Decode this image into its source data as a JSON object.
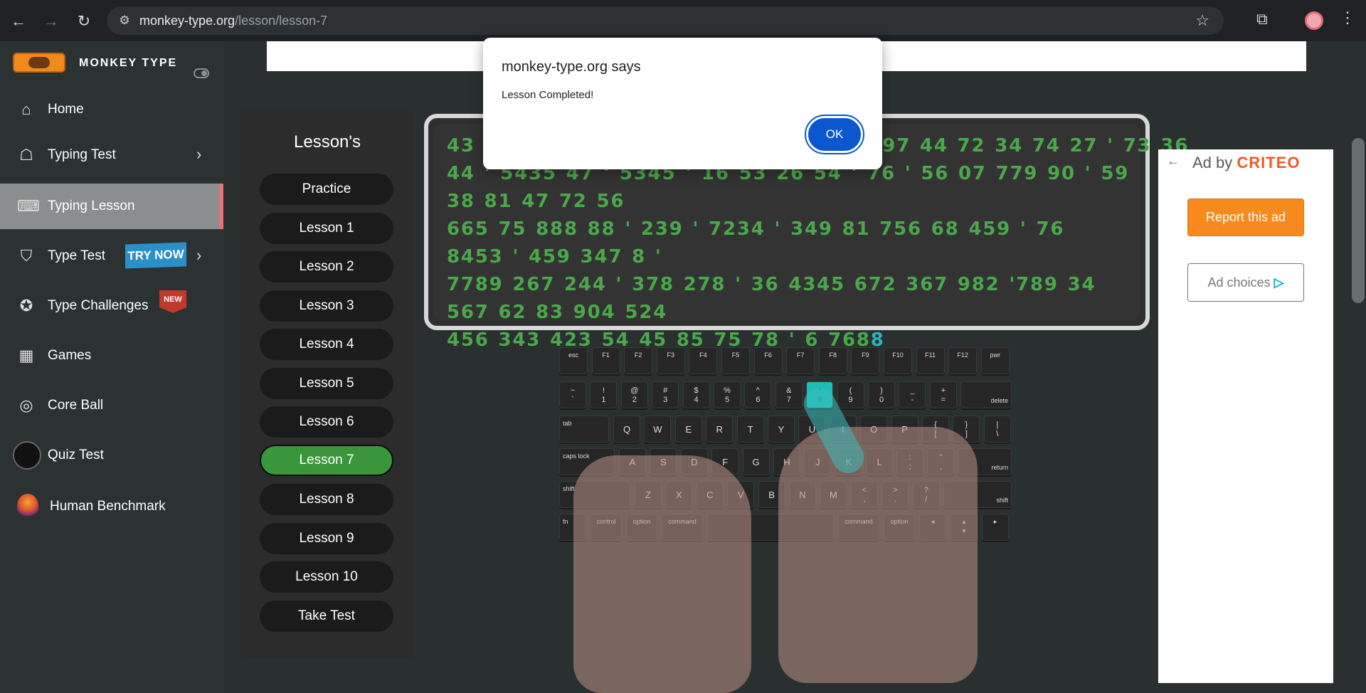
{
  "browser": {
    "url_host": "monkey-type.org",
    "url_path": "/lesson/lesson-7"
  },
  "sidebar": {
    "brand": "MONKEY TYPE",
    "items": [
      {
        "label": "Home",
        "icon": "home-icon"
      },
      {
        "label": "Typing Test",
        "icon": "github-cat-icon"
      },
      {
        "label": "Typing Lesson",
        "icon": "keyboard-icon"
      },
      {
        "label": "Type Test",
        "icon": "gitlab-fox-icon",
        "badge": "TRY NOW"
      },
      {
        "label": "Type Challenges",
        "icon": "award-icon",
        "badge": "NEW"
      },
      {
        "label": "Games",
        "icon": "grid-icon"
      },
      {
        "label": "Core Ball",
        "icon": "target-icon"
      },
      {
        "label": "Quiz Test",
        "icon": "bulb-icon"
      },
      {
        "label": "Human Benchmark",
        "icon": "brain-icon"
      }
    ]
  },
  "lessons": {
    "title": "Lesson's",
    "items": [
      "Practice",
      "Lesson 1",
      "Lesson 2",
      "Lesson 3",
      "Lesson 4",
      "Lesson 5",
      "Lesson 6",
      "Lesson 7",
      "Lesson 8",
      "Lesson 9",
      "Lesson 10",
      "Take Test"
    ],
    "active": "Lesson 7"
  },
  "typing": {
    "lines": [
      "43 0                                          97 44 72 34 74 27 ' 73 36",
      "44 ' 5435 47 ' 5345 ' 16 53 26 54 ' 76 ' 56 07 779 90 ' 59 38 81 47 72 56",
      "665 75 888 88 ' 239 ' 7234 ' 349 81 756 68 459 ' 76 8453 ' 459 347 8 '",
      "7789 267 244 ' 378 278 ' 36 4345 672 367 982 '789 34 567 62 83 904 524"
    ],
    "last_line": "456 343 423 54 45 85 75 78 ' 6 768",
    "cursor_char": "8"
  },
  "keyboard": {
    "row_fn": [
      "esc",
      "F1",
      "F2",
      "F3",
      "F4",
      "F5",
      "F6",
      "F7",
      "F8",
      "F9",
      "F10",
      "F11",
      "F12",
      "pwr"
    ],
    "row_num_top": [
      "~",
      "!",
      "@",
      "#",
      "$",
      "%",
      "^",
      "&",
      "*",
      "(",
      ")",
      "_",
      "+"
    ],
    "row_num_bottom": [
      "`",
      "1",
      "2",
      "3",
      "4",
      "5",
      "6",
      "7",
      "8",
      "9",
      "0",
      "-",
      "="
    ],
    "delete": "delete",
    "tab": "tab",
    "row_q": [
      "Q",
      "W",
      "E",
      "R",
      "T",
      "Y",
      "U",
      "I",
      "O",
      "P"
    ],
    "row_q_sym_top": [
      "{",
      "}",
      "|"
    ],
    "row_q_sym_bottom": [
      "[",
      "]",
      "\\"
    ],
    "caps": "caps lock",
    "row_a": [
      "A",
      "S",
      "D",
      "F",
      "G",
      "H",
      "J",
      "K",
      "L"
    ],
    "row_a_sym_top": [
      ":",
      "\""
    ],
    "row_a_sym_bottom": [
      ";",
      ","
    ],
    "return": "return",
    "shift": "shift",
    "row_z": [
      "Z",
      "X",
      "C",
      "V",
      "B",
      "N",
      "M"
    ],
    "row_z_sym_top": [
      "<",
      ">",
      "?"
    ],
    "row_z_sym_bottom": [
      ",",
      ".",
      "/"
    ],
    "bottom": [
      "fn",
      "control",
      "option",
      "command",
      "command",
      "option"
    ],
    "arrows": [
      "◂",
      "▴",
      "▾",
      "▸"
    ],
    "highlight_key": "8"
  },
  "ad": {
    "ad_by": "Ad by",
    "brand": "CRITEO",
    "report": "Report this ad",
    "choices": "Ad choices"
  },
  "dialog": {
    "title": "monkey-type.org says",
    "message": "Lesson Completed!",
    "ok": "OK"
  }
}
